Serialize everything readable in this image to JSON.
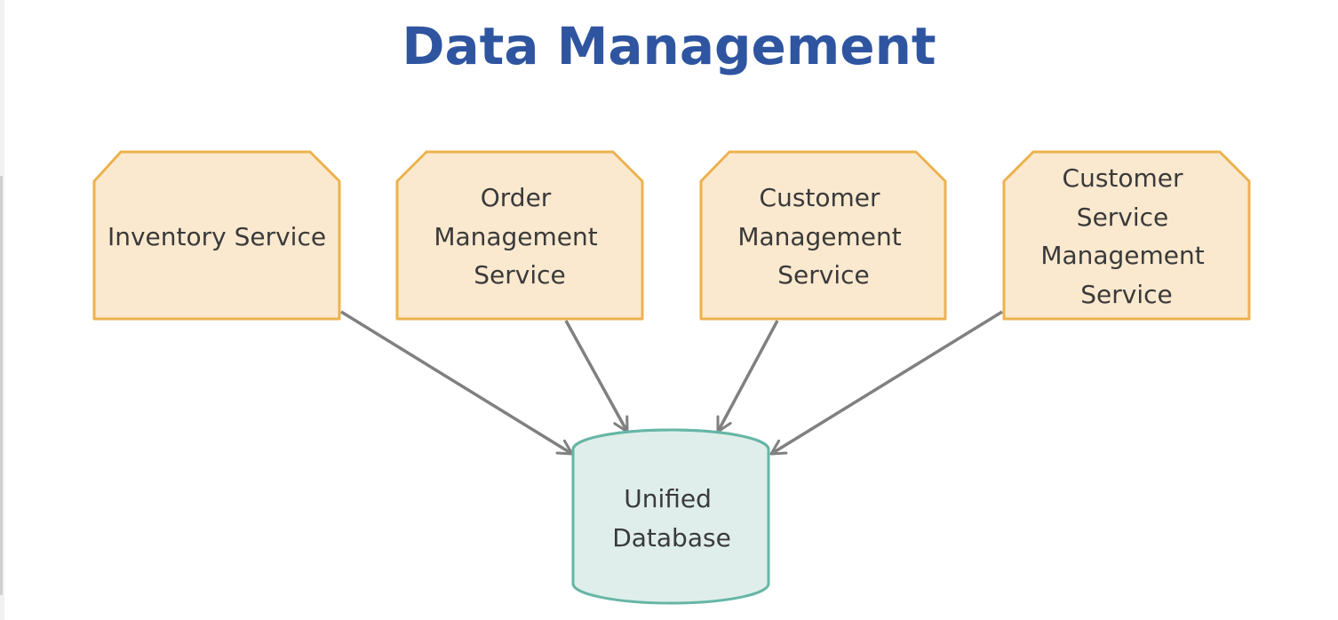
{
  "title": "Data Management",
  "colors": {
    "title": "#2f55a0",
    "service_fill": "#fbe9cf",
    "service_stroke": "#ecb24e",
    "database_fill": "#dfeeea",
    "database_stroke": "#66b6a6",
    "arrow": "#808080"
  },
  "services": [
    {
      "id": "inventory",
      "lines": [
        "Inventory Service"
      ]
    },
    {
      "id": "order",
      "lines": [
        "Order",
        "Management",
        "Service"
      ]
    },
    {
      "id": "customer",
      "lines": [
        "Customer",
        "Management",
        "Service"
      ]
    },
    {
      "id": "customer-service",
      "lines": [
        "Customer",
        "Service",
        "Management",
        "Service"
      ]
    }
  ],
  "database": {
    "lines": [
      "Unified",
      "Database"
    ]
  }
}
